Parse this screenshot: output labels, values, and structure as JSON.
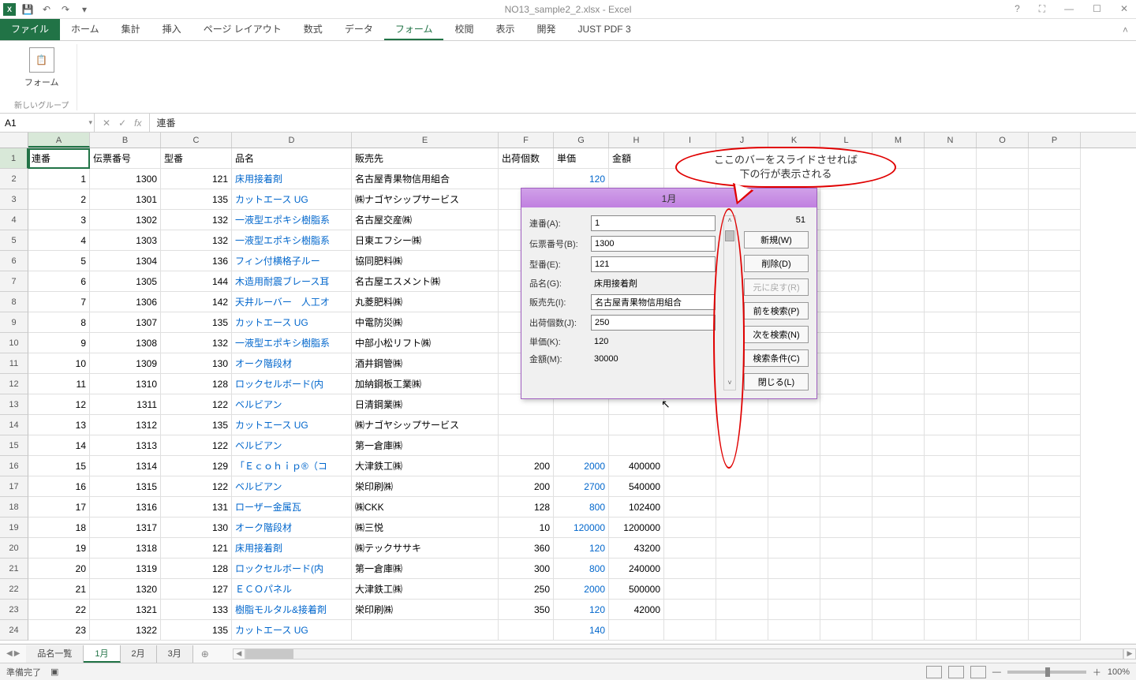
{
  "title": "NO13_sample2_2.xlsx - Excel",
  "ribbon": {
    "tabs": [
      "ファイル",
      "ホーム",
      "集計",
      "挿入",
      "ページ レイアウト",
      "数式",
      "データ",
      "フォーム",
      "校閲",
      "表示",
      "開発",
      "JUST PDF 3"
    ],
    "active_tab": "フォーム",
    "form_button": "フォーム",
    "group_label": "新しいグループ"
  },
  "namebox": "A1",
  "formula": "連番",
  "columns": [
    "A",
    "B",
    "C",
    "D",
    "E",
    "F",
    "G",
    "H",
    "I",
    "J",
    "K",
    "L",
    "M",
    "N",
    "O",
    "P"
  ],
  "headers": [
    "連番",
    "伝票番号",
    "型番",
    "品名",
    "販売先",
    "出荷個数",
    "単価",
    "金額"
  ],
  "rows": [
    {
      "n": 1,
      "a": 1,
      "b": 1300,
      "c": 121,
      "d": "床用接着剤",
      "e": "名古屋青果物信用組合",
      "f": "",
      "g": "120",
      "h": ""
    },
    {
      "n": 2,
      "a": 2,
      "b": 1301,
      "c": 135,
      "d": "カットエース UG",
      "e": "㈱ナゴヤシップサービス",
      "f": "",
      "g": "",
      "h": ""
    },
    {
      "n": 3,
      "a": 3,
      "b": 1302,
      "c": 132,
      "d": "一液型エポキシ樹脂系",
      "e": "名古屋交産㈱",
      "f": "",
      "g": "",
      "h": ""
    },
    {
      "n": 4,
      "a": 4,
      "b": 1303,
      "c": 132,
      "d": "一液型エポキシ樹脂系",
      "e": "日東エフシー㈱",
      "f": "",
      "g": "",
      "h": ""
    },
    {
      "n": 5,
      "a": 5,
      "b": 1304,
      "c": 136,
      "d": "フィン付横格子ルー",
      "e": "協同肥料㈱",
      "f": "",
      "g": "",
      "h": ""
    },
    {
      "n": 6,
      "a": 6,
      "b": 1305,
      "c": 144,
      "d": "木造用耐震ブレース耳",
      "e": "名古屋エスメント㈱",
      "f": "",
      "g": "",
      "h": ""
    },
    {
      "n": 7,
      "a": 7,
      "b": 1306,
      "c": 142,
      "d": "天井ルーバー　人工オ",
      "e": "丸菱肥料㈱",
      "f": "",
      "g": "",
      "h": ""
    },
    {
      "n": 8,
      "a": 8,
      "b": 1307,
      "c": 135,
      "d": "カットエース UG",
      "e": "中電防災㈱",
      "f": "",
      "g": "",
      "h": ""
    },
    {
      "n": 9,
      "a": 9,
      "b": 1308,
      "c": 132,
      "d": "一液型エポキシ樹脂系",
      "e": "中部小松リフト㈱",
      "f": "",
      "g": "",
      "h": ""
    },
    {
      "n": 10,
      "a": 10,
      "b": 1309,
      "c": 130,
      "d": "オーク階段材",
      "e": "酒井鋼管㈱",
      "f": "",
      "g": "",
      "h": ""
    },
    {
      "n": 11,
      "a": 11,
      "b": 1310,
      "c": 128,
      "d": "ロックセルボード(内",
      "e": "加納鋼板工業㈱",
      "f": "",
      "g": "",
      "h": ""
    },
    {
      "n": 12,
      "a": 12,
      "b": 1311,
      "c": 122,
      "d": "ベルビアン",
      "e": "日清鋼業㈱",
      "f": "",
      "g": "",
      "h": ""
    },
    {
      "n": 13,
      "a": 13,
      "b": 1312,
      "c": 135,
      "d": "カットエース UG",
      "e": "㈱ナゴヤシップサービス",
      "f": "",
      "g": "",
      "h": ""
    },
    {
      "n": 14,
      "a": 14,
      "b": 1313,
      "c": 122,
      "d": "ベルビアン",
      "e": "第一倉庫㈱",
      "f": "",
      "g": "",
      "h": ""
    },
    {
      "n": 15,
      "a": 15,
      "b": 1314,
      "c": 129,
      "d": "「Ｅｃｏｈｉｐ®（コ",
      "e": "大津鉄工㈱",
      "f": "200",
      "g": "2000",
      "h": "400000"
    },
    {
      "n": 16,
      "a": 16,
      "b": 1315,
      "c": 122,
      "d": "ベルビアン",
      "e": "栄印刷㈱",
      "f": "200",
      "g": "2700",
      "h": "540000"
    },
    {
      "n": 17,
      "a": 17,
      "b": 1316,
      "c": 131,
      "d": "ローザー金属瓦",
      "e": "㈱CKK",
      "f": "128",
      "g": "800",
      "h": "102400"
    },
    {
      "n": 18,
      "a": 18,
      "b": 1317,
      "c": 130,
      "d": "オーク階段材",
      "e": "㈱三悦",
      "f": "10",
      "g": "120000",
      "h": "1200000"
    },
    {
      "n": 19,
      "a": 19,
      "b": 1318,
      "c": 121,
      "d": "床用接着剤",
      "e": "㈱テックササキ",
      "f": "360",
      "g": "120",
      "h": "43200"
    },
    {
      "n": 20,
      "a": 20,
      "b": 1319,
      "c": 128,
      "d": "ロックセルボード(内",
      "e": "第一倉庫㈱",
      "f": "300",
      "g": "800",
      "h": "240000"
    },
    {
      "n": 21,
      "a": 21,
      "b": 1320,
      "c": 127,
      "d": "ＥＣＯパネル",
      "e": "大津鉄工㈱",
      "f": "250",
      "g": "2000",
      "h": "500000"
    },
    {
      "n": 22,
      "a": 22,
      "b": 1321,
      "c": 133,
      "d": "樹脂モルタル&接着剤",
      "e": "栄印刷㈱",
      "f": "350",
      "g": "120",
      "h": "42000"
    },
    {
      "n": 23,
      "a": 23,
      "b": 1322,
      "c": 135,
      "d": "カットエース UG",
      "e": "",
      "f": "",
      "g": "140",
      "h": ""
    }
  ],
  "form_dialog": {
    "title": "1月",
    "counter": "51",
    "fields": {
      "renban_label": "連番(A):",
      "renban": "1",
      "denpyo_label": "伝票番号(B):",
      "denpyo": "1300",
      "kataban_label": "型番(E):",
      "kataban": "121",
      "hinmei_label": "品名(G):",
      "hinmei": "床用接着剤",
      "hanbai_label": "販売先(I):",
      "hanbai": "名古屋青果物信用組合",
      "shukka_label": "出荷個数(J):",
      "shukka": "250",
      "tanka_label": "単価(K):",
      "tanka": "120",
      "kingaku_label": "金額(M):",
      "kingaku": "30000"
    },
    "buttons": {
      "new": "新規(W)",
      "delete": "削除(D)",
      "restore": "元に戻す(R)",
      "prev": "前を検索(P)",
      "next": "次を検索(N)",
      "criteria": "検索条件(C)",
      "close": "閉じる(L)"
    }
  },
  "callout": {
    "line1": "ここのバーをスライドさせれば",
    "line2": "下の行が表示される"
  },
  "sheets": {
    "tabs": [
      "品名一覧",
      "1月",
      "2月",
      "3月"
    ],
    "active": "1月"
  },
  "statusbar": {
    "ready": "準備完了",
    "zoom": "100%"
  }
}
